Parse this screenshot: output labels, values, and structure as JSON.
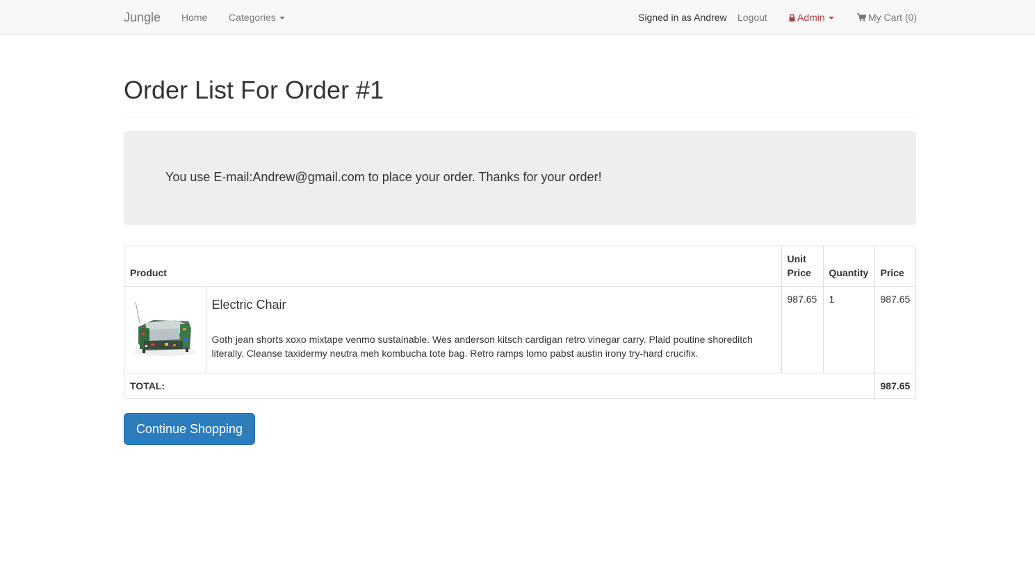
{
  "navbar": {
    "brand": "Jungle",
    "home": "Home",
    "categories": "Categories",
    "signed_in": "Signed in as Andrew",
    "logout": "Logout",
    "admin": "Admin",
    "cart": "My Cart (0)"
  },
  "page": {
    "title": "Order List For Order #1"
  },
  "notice": {
    "message": "You use E-mail:Andrew@gmail.com to place your order. Thanks for your order!"
  },
  "table": {
    "headers": {
      "product": "Product",
      "unit_price": "Unit Price",
      "quantity": "Quantity",
      "price": "Price"
    },
    "rows": [
      {
        "name": "Electric Chair",
        "description": "Goth jean shorts xoxo mixtape venmo sustainable. Wes anderson kitsch cardigan retro vinegar carry. Plaid poutine shoreditch literally. Cleanse taxidermy neutra meh kombucha tote bag. Retro ramps lomo pabst austin irony try-hard crucifix.",
        "unit_price": "987.65",
        "quantity": "1",
        "price": "987.65"
      }
    ],
    "total_label": "TOTAL:",
    "total_value": "987.65"
  },
  "actions": {
    "continue": "Continue Shopping"
  },
  "colors": {
    "navbar_bg": "#f8f8f8",
    "admin": "#a94442",
    "primary_button": "#2d7dbd",
    "jumbotron_bg": "#eeeeee"
  }
}
